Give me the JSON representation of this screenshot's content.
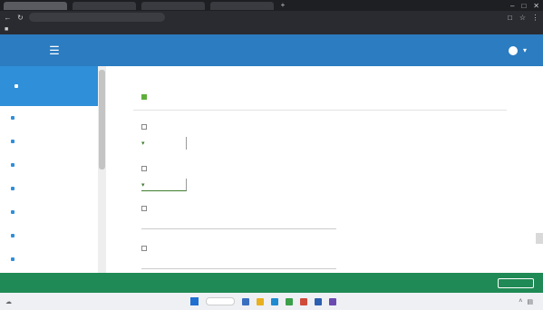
{
  "browser": {
    "tabs": [
      "",
      "",
      "",
      ""
    ],
    "address": "",
    "bookmark_label": ""
  },
  "header": {
    "user_name": "",
    "menu_icon": "hamburger-icon"
  },
  "sidebar": {
    "items": [
      {
        "label": "",
        "active": true
      },
      {
        "label": ""
      },
      {
        "label": ""
      },
      {
        "label": ""
      },
      {
        "label": ""
      },
      {
        "label": ""
      },
      {
        "label": ""
      },
      {
        "label": ""
      }
    ]
  },
  "main": {
    "section_title": "",
    "fields": [
      {
        "label": "",
        "value": ""
      },
      {
        "label": "",
        "value": ""
      },
      {
        "label": "",
        "value": ""
      },
      {
        "label": "",
        "value": ""
      }
    ]
  },
  "footer": {
    "left_text": "",
    "button_label": ""
  },
  "taskbar": {
    "weather": "",
    "clock": ""
  },
  "colors": {
    "header_blue": "#2b7cc0",
    "active_item_blue": "#2f8fd8",
    "footer_green": "#1f8a55",
    "select_green": "#3f7f2f"
  }
}
